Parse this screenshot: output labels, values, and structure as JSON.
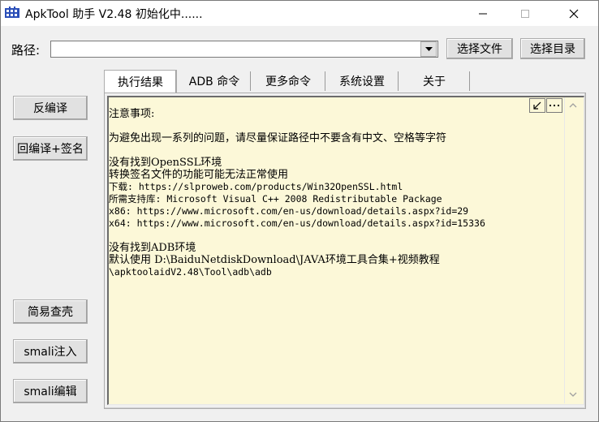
{
  "window": {
    "title": "ApkTool 助手 V2.48  初始化中......",
    "icon": "apktool-app-icon"
  },
  "path_row": {
    "label": "路径:",
    "value": "",
    "select_file_label": "选择文件",
    "select_dir_label": "选择目录"
  },
  "left_buttons": {
    "decompile": "反编译",
    "recompile_sign": "回编译+签名",
    "unpack": "简易查壳",
    "smali_inject": "smali注入",
    "smali_edit": "smali编辑"
  },
  "tabs": [
    {
      "label": "执行结果",
      "active": true
    },
    {
      "label": "ADB 命令",
      "active": false
    },
    {
      "label": "更多命令",
      "active": false
    },
    {
      "label": "系统设置",
      "active": false
    },
    {
      "label": "关于",
      "active": false
    }
  ],
  "output": {
    "notice_title": "注意事项:",
    "notice_body": "为避免出现一系列的问题，请尽量保证路径中不要含有中文、空格等字符",
    "openssl_missing": "没有找到OpenSSL环境",
    "openssl_warn": "转换签名文件的功能可能无法正常使用",
    "download_line": "下载: https://slproweb.com/products/Win32OpenSSL.html",
    "support_line": "所需支持库: Microsoft Visual C++ 2008 Redistributable Package",
    "x86_line": "x86: https://www.microsoft.com/en-us/download/details.aspx?id=29",
    "x64_line": "x64: https://www.microsoft.com/en-us/download/details.aspx?id=15336",
    "adb_missing": "没有找到ADB环境",
    "adb_default_1": "默认使用 D:\\BaiduNetdiskDownload\\JAVA环境工具合集+视频教程",
    "adb_default_2": "\\apktoolaidV2.48\\Tool\\adb\\adb"
  },
  "colors": {
    "output_background": "#fcf8d8",
    "window_background": "#f0f0f0",
    "button_face": "#e1e1e1"
  }
}
